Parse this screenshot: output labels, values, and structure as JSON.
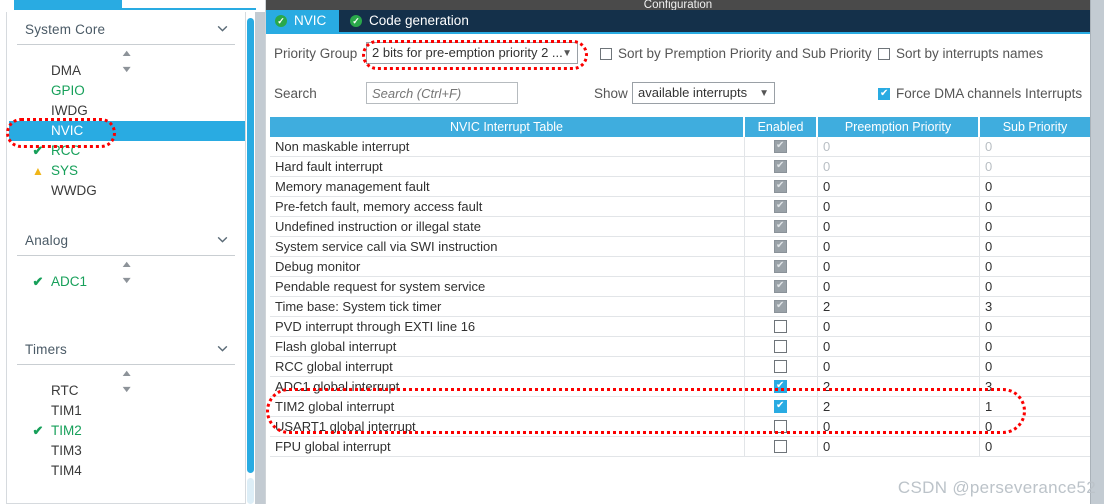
{
  "sidebar": {
    "groups": [
      {
        "title": "System Core",
        "chevron_icon": "chevron-down-icon",
        "spinner_icon": "spinner-updown-icon",
        "items": [
          {
            "label": "DMA",
            "state": "normal",
            "mark": ""
          },
          {
            "label": "GPIO",
            "state": "green",
            "mark": ""
          },
          {
            "label": "IWDG",
            "state": "normal",
            "mark": ""
          },
          {
            "label": "NVIC",
            "state": "selected",
            "mark": ""
          },
          {
            "label": "RCC",
            "state": "green",
            "mark": "check-icon"
          },
          {
            "label": "SYS",
            "state": "green",
            "mark": "warning-icon"
          },
          {
            "label": "WWDG",
            "state": "normal",
            "mark": ""
          }
        ]
      },
      {
        "title": "Analog",
        "chevron_icon": "chevron-down-icon",
        "spinner_icon": "spinner-updown-icon",
        "items": [
          {
            "label": "ADC1",
            "state": "green",
            "mark": "check-icon"
          }
        ]
      },
      {
        "title": "Timers",
        "chevron_icon": "chevron-down-icon",
        "spinner_icon": "spinner-updown-icon",
        "items": [
          {
            "label": "RTC",
            "state": "normal",
            "mark": ""
          },
          {
            "label": "TIM1",
            "state": "normal",
            "mark": ""
          },
          {
            "label": "TIM2",
            "state": "green",
            "mark": "check-icon"
          },
          {
            "label": "TIM3",
            "state": "normal",
            "mark": ""
          },
          {
            "label": "TIM4",
            "state": "normal",
            "mark": ""
          }
        ]
      }
    ]
  },
  "config": {
    "window_title": "Configuration",
    "tabs": [
      {
        "label": "NVIC",
        "active": true,
        "status_icon": "green-check-circle-icon"
      },
      {
        "label": "Code generation",
        "active": false,
        "status_icon": "green-check-circle-icon"
      }
    ],
    "toolbar": {
      "priority_group_label": "Priority Group",
      "priority_group_value": "2 bits for pre-emption priority 2 ...",
      "search_label": "Search",
      "search_placeholder": "Search (Ctrl+F)",
      "search_value": "",
      "prev_icon": "circle-left-arrow-icon",
      "next_icon": "circle-right-arrow-icon",
      "show_label": "Show",
      "show_value": "available interrupts",
      "sort_premption_label": "Sort by Premption Priority and Sub Priority",
      "sort_premption_checked": false,
      "sort_names_label": "Sort by interrupts names",
      "sort_names_checked": false,
      "force_dma_label": "Force DMA channels Interrupts",
      "force_dma_checked": true
    },
    "table": {
      "headers": [
        "NVIC Interrupt Table",
        "Enabled",
        "Preemption Priority",
        "Sub Priority"
      ],
      "rows": [
        {
          "name": "Non maskable interrupt",
          "enabled": "disabled-checked",
          "preemption": "0",
          "sub": "0",
          "muted": true
        },
        {
          "name": "Hard fault interrupt",
          "enabled": "disabled-checked",
          "preemption": "0",
          "sub": "0",
          "muted": true
        },
        {
          "name": "Memory management fault",
          "enabled": "disabled-checked",
          "preemption": "0",
          "sub": "0",
          "muted": false
        },
        {
          "name": "Pre-fetch fault, memory access fault",
          "enabled": "disabled-checked",
          "preemption": "0",
          "sub": "0",
          "muted": false
        },
        {
          "name": "Undefined instruction or illegal state",
          "enabled": "disabled-checked",
          "preemption": "0",
          "sub": "0",
          "muted": false
        },
        {
          "name": "System service call via SWI instruction",
          "enabled": "disabled-checked",
          "preemption": "0",
          "sub": "0",
          "muted": false
        },
        {
          "name": "Debug monitor",
          "enabled": "disabled-checked",
          "preemption": "0",
          "sub": "0",
          "muted": false
        },
        {
          "name": "Pendable request for system service",
          "enabled": "disabled-checked",
          "preemption": "0",
          "sub": "0",
          "muted": false
        },
        {
          "name": "Time base: System tick timer",
          "enabled": "disabled-checked",
          "preemption": "2",
          "sub": "3",
          "muted": false
        },
        {
          "name": "PVD interrupt through EXTI line 16",
          "enabled": "unchecked",
          "preemption": "0",
          "sub": "0",
          "muted": false
        },
        {
          "name": "Flash global interrupt",
          "enabled": "unchecked",
          "preemption": "0",
          "sub": "0",
          "muted": false
        },
        {
          "name": "RCC global interrupt",
          "enabled": "unchecked",
          "preemption": "0",
          "sub": "0",
          "muted": false
        },
        {
          "name": "ADC1 global interrupt",
          "enabled": "checked",
          "preemption": "2",
          "sub": "3",
          "muted": false
        },
        {
          "name": "TIM2 global interrupt",
          "enabled": "checked",
          "preemption": "2",
          "sub": "1",
          "muted": false
        },
        {
          "name": "USART1 global interrupt",
          "enabled": "unchecked",
          "preemption": "0",
          "sub": "0",
          "muted": false
        },
        {
          "name": "FPU global interrupt",
          "enabled": "unchecked",
          "preemption": "0",
          "sub": "0",
          "muted": false
        }
      ]
    }
  },
  "annotations": {
    "highlight_color": "#fb0000",
    "regions": [
      "nvic-sidebar-item",
      "priority-group-dropdown",
      "adc1-and-tim2-rows"
    ]
  },
  "watermark": {
    "text": "CSDN @perseverance52"
  },
  "theme": {
    "accent": "#29abe2",
    "tab_inactive": "#14304a",
    "header_blue": "#3fadde",
    "green": "#17a05a",
    "warning": "#f0b518"
  }
}
